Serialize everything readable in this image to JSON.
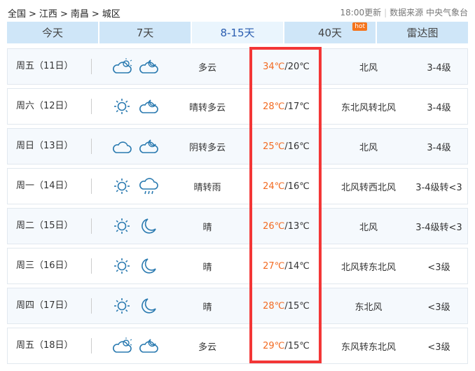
{
  "breadcrumb": [
    "全国",
    ">",
    "江西",
    ">",
    "南昌",
    ">",
    "城区"
  ],
  "update": "18:00更新",
  "source": "数据来源 中央气象台",
  "tabs": [
    {
      "label": "今天"
    },
    {
      "label": "7天"
    },
    {
      "label": "8-15天",
      "active": true
    },
    {
      "label": "40天",
      "badge": "hot"
    },
    {
      "label": "雷达图"
    }
  ],
  "rows": [
    {
      "day": "周五（11日）",
      "icons": [
        "cloud-sun",
        "cloud-moon"
      ],
      "desc": "多云",
      "hi": "34℃",
      "lo": "/20℃",
      "wind": "北风",
      "level": "3-4级"
    },
    {
      "day": "周六（12日）",
      "icons": [
        "sun",
        "cloud-moon"
      ],
      "desc": "晴转多云",
      "hi": "28℃",
      "lo": "/17℃",
      "wind": "东北风转北风",
      "level": "3-4级"
    },
    {
      "day": "周日（13日）",
      "icons": [
        "cloud",
        "cloud-moon"
      ],
      "desc": "阴转多云",
      "hi": "25℃",
      "lo": "/16℃",
      "wind": "北风",
      "level": "3-4级"
    },
    {
      "day": "周一（14日）",
      "icons": [
        "sun",
        "rain"
      ],
      "desc": "晴转雨",
      "hi": "24℃",
      "lo": "/16℃",
      "wind": "北风转西北风",
      "level": "3-4级转<3"
    },
    {
      "day": "周二（15日）",
      "icons": [
        "sun",
        "moon"
      ],
      "desc": "晴",
      "hi": "26℃",
      "lo": "/13℃",
      "wind": "北风",
      "level": "3-4级转<3"
    },
    {
      "day": "周三（16日）",
      "icons": [
        "sun",
        "moon"
      ],
      "desc": "晴",
      "hi": "27℃",
      "lo": "/14℃",
      "wind": "北风转东北风",
      "level": "<3级"
    },
    {
      "day": "周四（17日）",
      "icons": [
        "sun",
        "moon"
      ],
      "desc": "晴",
      "hi": "28℃",
      "lo": "/15℃",
      "wind": "东北风",
      "level": "<3级"
    },
    {
      "day": "周五（18日）",
      "icons": [
        "cloud-sun",
        "cloud-moon"
      ],
      "desc": "多云",
      "hi": "29℃",
      "lo": "/15℃",
      "wind": "东风转东北风",
      "level": "<3级"
    }
  ],
  "colors": {
    "accent": "#f26a21",
    "highlight": "#f33636",
    "icon": "#2a7ab0"
  }
}
